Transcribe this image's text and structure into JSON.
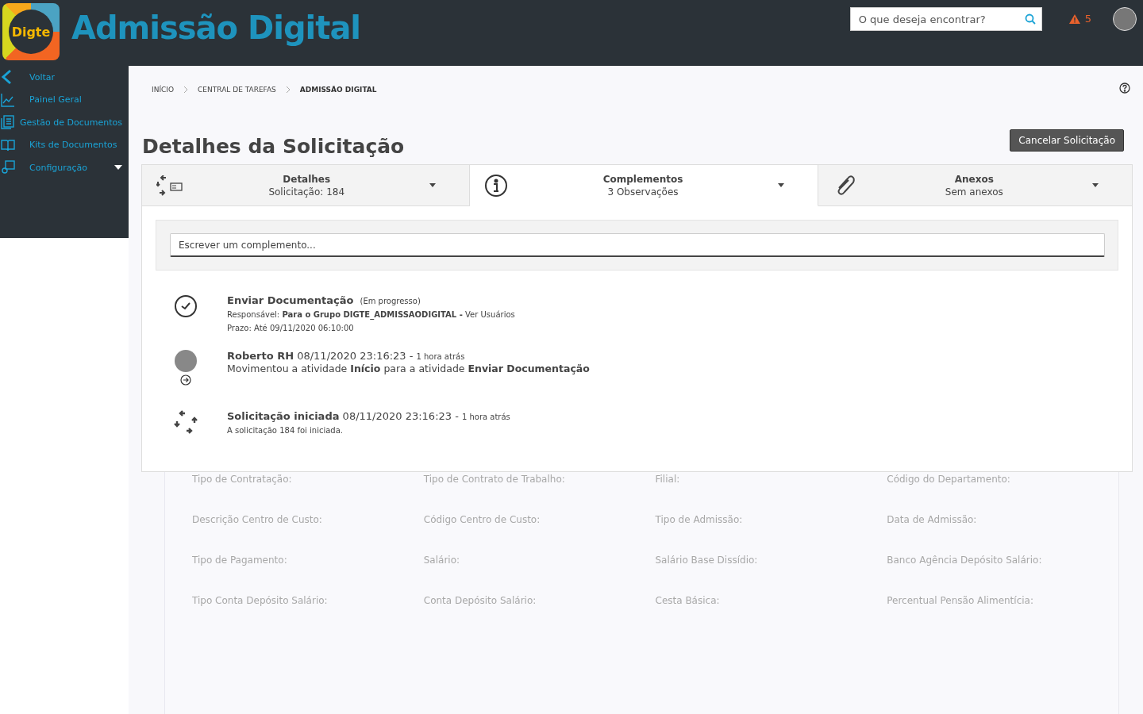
{
  "header": {
    "logo_text": "Digte",
    "app_title": "Admissão Digital",
    "search": {
      "placeholder": "O que deseja encontrar?"
    },
    "alerts": "5"
  },
  "sidebar": {
    "items": [
      {
        "label": "Voltar",
        "kind": "back"
      },
      {
        "label": "Painel Geral",
        "kind": "chart"
      },
      {
        "label": "Gestão de Documentos",
        "kind": "docs"
      },
      {
        "label": "Kits de Documentos",
        "kind": "book"
      },
      {
        "label": "Configuração",
        "kind": "config",
        "expanded": false
      }
    ]
  },
  "breadcrumb": [
    {
      "label": "INÍCIO",
      "current": false
    },
    {
      "label": "CENTRAL DE TAREFAS",
      "current": false
    },
    {
      "label": "ADMISSÃO DIGITAL",
      "current": true
    }
  ],
  "page_title": "Detalhes da Solicitação",
  "cancel_button": "Cancelar Solicitação",
  "tabs": [
    {
      "title": "Detalhes",
      "subtitle": "Solicitação: 184",
      "kind": "details",
      "selected": false
    },
    {
      "title": "Complementos",
      "subtitle": "3 Observações",
      "kind": "info",
      "selected": true
    },
    {
      "title": "Anexos",
      "subtitle": "Sem anexos",
      "kind": "attach",
      "selected": false
    }
  ],
  "comment_field": {
    "placeholder": "Escrever um complemento..."
  },
  "timeline": [
    {
      "kind": "task",
      "heading": "**Enviar Documentação**",
      "note": "(Em progresso)",
      "lines": [
        "Responsável: **Para o Grupo DIGTE_ADMISSAODIGITAL -** Ver Usuários",
        "Prazo: Até 09/11/2020 06:10:00"
      ]
    },
    {
      "kind": "user",
      "heading": "**Roberto RH** 08/11/2020 23:16:23 -",
      "note": "1 hora atrás",
      "lines": [
        "Movimentou a atividade **Início**  para a atividade **Enviar Documentação**"
      ]
    },
    {
      "kind": "start",
      "heading": "**Solicitação iniciada** 08/11/2020 23:16:23 -",
      "note": "1 hora atrás",
      "lines": [
        "A solicitação  184  foi iniciada."
      ]
    }
  ],
  "fields": [
    "Tipo de Contratação:",
    "Tipo de Contrato de Trabalho:",
    "Filial:",
    "Código do Departamento:",
    "Descrição Centro de Custo:",
    "Código Centro de Custo:",
    "Tipo de Admissão:",
    "Data de Admissão:",
    "Tipo de Pagamento:",
    "Salário:",
    "Salário Base Dissídio:",
    "Banco Agência Depósito Salário:",
    "Tipo Conta Depósito Salário:",
    "Conta Depósito Salário:",
    "Cesta Básica:",
    "Percentual Pensão Alimentícia:"
  ]
}
